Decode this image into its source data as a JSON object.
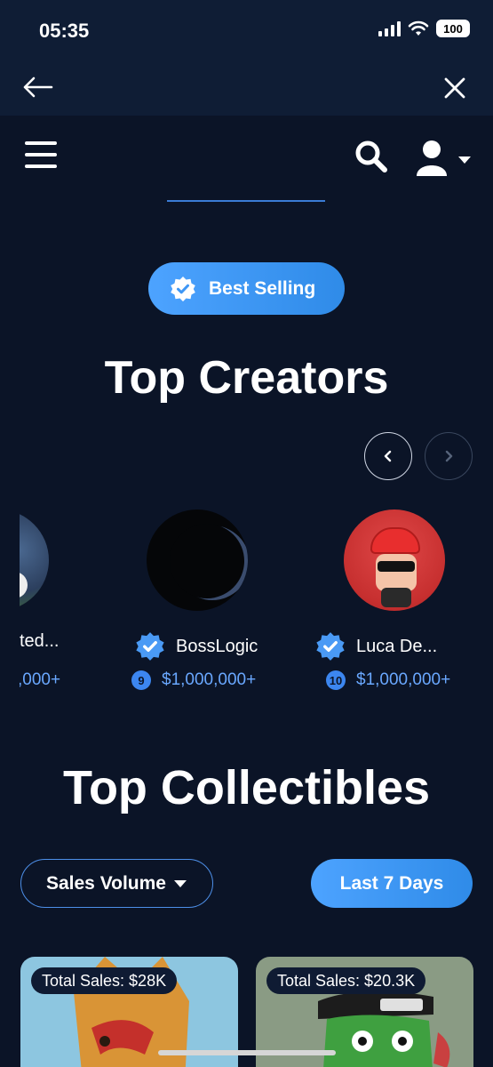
{
  "status_bar": {
    "time": "05:35",
    "battery": "100"
  },
  "browser": {
    "back_icon": "arrow-left-icon",
    "close_icon": "close-icon"
  },
  "nav": {
    "menu_icon": "hamburger-icon",
    "search_icon": "search-icon",
    "user_icon": "user-icon"
  },
  "badge": {
    "label": "Best Selling"
  },
  "top_creators": {
    "title": "Top Creators",
    "creators": [
      {
        "name": "ted...",
        "rank": "",
        "sales": ",000+"
      },
      {
        "name": "BossLogic",
        "rank": "9",
        "sales": "$1,000,000+"
      },
      {
        "name": "Luca De...",
        "rank": "10",
        "sales": "$1,000,000+"
      }
    ]
  },
  "top_collectibles": {
    "title": "Top Collectibles",
    "filter_label": "Sales Volume",
    "period_label": "Last 7 Days",
    "cards": [
      {
        "sales": "Total Sales: $28K"
      },
      {
        "sales": "Total Sales: $20.3K"
      }
    ]
  },
  "colors": {
    "background": "#0b1427",
    "accent": "#3c8ef0",
    "link": "#6aa8ff"
  }
}
